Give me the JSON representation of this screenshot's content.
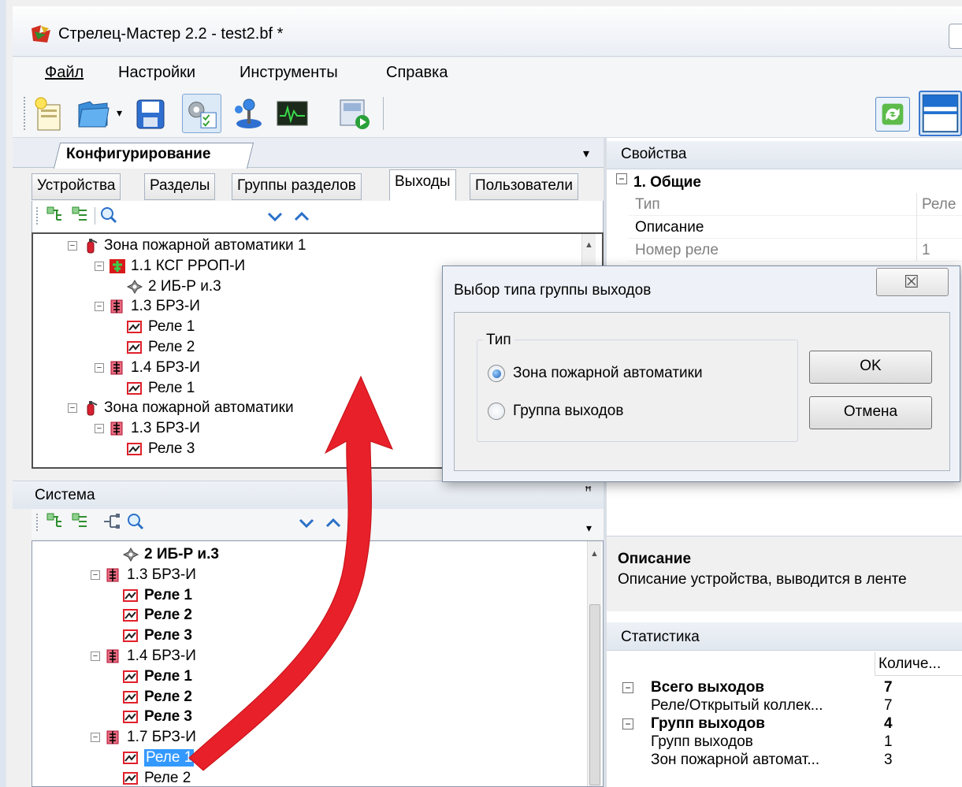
{
  "window": {
    "title": "Стрелец-Мастер 2.2 - test2.bf *"
  },
  "menu": [
    "Файл",
    "Настройки",
    "Инструменты",
    "Справка"
  ],
  "config_pane": {
    "header": "Конфигурирование",
    "tabs": [
      "Устройства",
      "Разделы",
      "Группы разделов",
      "Выходы",
      "Пользователи"
    ],
    "active_tab": "Выходы",
    "tree": [
      {
        "text": "Зона пожарной автоматики 1",
        "icon": "fire-extinguisher-icon",
        "level": 0,
        "expander": "−"
      },
      {
        "text": "1.1 КСГ РРОП-И",
        "icon": "device-green-icon",
        "level": 1,
        "expander": "−"
      },
      {
        "text": "2 ИБ-Р и.3",
        "icon": "sensor-icon",
        "level": 2,
        "expander": ""
      },
      {
        "text": "1.3 БРЗ-И",
        "icon": "relay-block-icon",
        "level": 1,
        "expander": "−"
      },
      {
        "text": "Реле 1",
        "icon": "relay-icon",
        "level": 2,
        "expander": ""
      },
      {
        "text": "Реле 2",
        "icon": "relay-icon",
        "level": 2,
        "expander": ""
      },
      {
        "text": "1.4 БРЗ-И",
        "icon": "relay-block-icon",
        "level": 1,
        "expander": "−"
      },
      {
        "text": "Реле 1",
        "icon": "relay-icon",
        "level": 2,
        "expander": ""
      },
      {
        "text": "Зона пожарной автоматики",
        "icon": "fire-extinguisher-icon",
        "level": 0,
        "expander": "−"
      },
      {
        "text": "1.3 БРЗ-И",
        "icon": "relay-block-icon",
        "level": 1,
        "expander": "−"
      },
      {
        "text": "Реле 3",
        "icon": "relay-icon",
        "level": 2,
        "expander": ""
      }
    ]
  },
  "system_pane": {
    "header": "Система",
    "tree": [
      {
        "text": "2 ИБ-Р и.3",
        "icon": "sensor-icon",
        "level": 2,
        "bold": true,
        "expander": ""
      },
      {
        "text": "1.3 БРЗ-И",
        "icon": "relay-block-icon",
        "level": 1,
        "bold": false,
        "expander": "−"
      },
      {
        "text": "Реле 1",
        "icon": "relay-icon",
        "level": 2,
        "bold": true,
        "expander": ""
      },
      {
        "text": "Реле 2",
        "icon": "relay-icon",
        "level": 2,
        "bold": true,
        "expander": ""
      },
      {
        "text": "Реле 3",
        "icon": "relay-icon",
        "level": 2,
        "bold": true,
        "expander": ""
      },
      {
        "text": "1.4 БРЗ-И",
        "icon": "relay-block-icon",
        "level": 1,
        "bold": false,
        "expander": "−"
      },
      {
        "text": "Реле 1",
        "icon": "relay-icon",
        "level": 2,
        "bold": true,
        "expander": ""
      },
      {
        "text": "Реле 2",
        "icon": "relay-icon",
        "level": 2,
        "bold": true,
        "expander": ""
      },
      {
        "text": "Реле 3",
        "icon": "relay-icon",
        "level": 2,
        "bold": true,
        "expander": ""
      },
      {
        "text": "1.7 БРЗ-И",
        "icon": "relay-block-icon",
        "level": 1,
        "bold": false,
        "expander": "−"
      },
      {
        "text": "Реле 1",
        "icon": "relay-icon",
        "level": 2,
        "bold": false,
        "selected": true,
        "expander": ""
      },
      {
        "text": "Реле 2",
        "icon": "relay-icon",
        "level": 2,
        "bold": false,
        "expander": ""
      }
    ]
  },
  "properties": {
    "header": "Свойства",
    "group": "1. Общие",
    "group_expander": "−",
    "rows": [
      {
        "name": "Тип",
        "value": "Реле",
        "disabled": true
      },
      {
        "name": "Описание",
        "value": "",
        "disabled": false
      },
      {
        "name": "Номер реле",
        "value": "1",
        "disabled": true
      }
    ],
    "desc_title": "Описание",
    "desc_text": "Описание устройства, выводится в ленте"
  },
  "statistics": {
    "header": "Статистика",
    "column": "Количе...",
    "rows": [
      {
        "name": "Всего выходов",
        "value": "7",
        "bold": true,
        "expander": "−"
      },
      {
        "name": "Реле/Открытый коллек...",
        "value": "7",
        "bold": false,
        "expander": ""
      },
      {
        "name": "Групп выходов",
        "value": "4",
        "bold": true,
        "expander": "−"
      },
      {
        "name": "Групп выходов",
        "value": "1",
        "bold": false,
        "expander": ""
      },
      {
        "name": "Зон пожарной автомат...",
        "value": "3",
        "bold": false,
        "expander": ""
      }
    ]
  },
  "dialog": {
    "title": "Выбор типа группы выходов",
    "group_label": "Тип",
    "options": [
      "Зона пожарной автоматики",
      "Группа выходов"
    ],
    "selected_option": "Зона пожарной автоматики",
    "ok": "OK",
    "cancel": "Отмена",
    "close_glyph": "☒"
  },
  "glyphs": {
    "dropdown": "▾",
    "pin": "ꟸ",
    "scroll_up": "▲",
    "chevron_down": "⌄",
    "chevron_up": "⌃",
    "search": "🔍"
  },
  "colors": {
    "annotation_arrow": "#e8202a",
    "selection": "#3399ff"
  }
}
